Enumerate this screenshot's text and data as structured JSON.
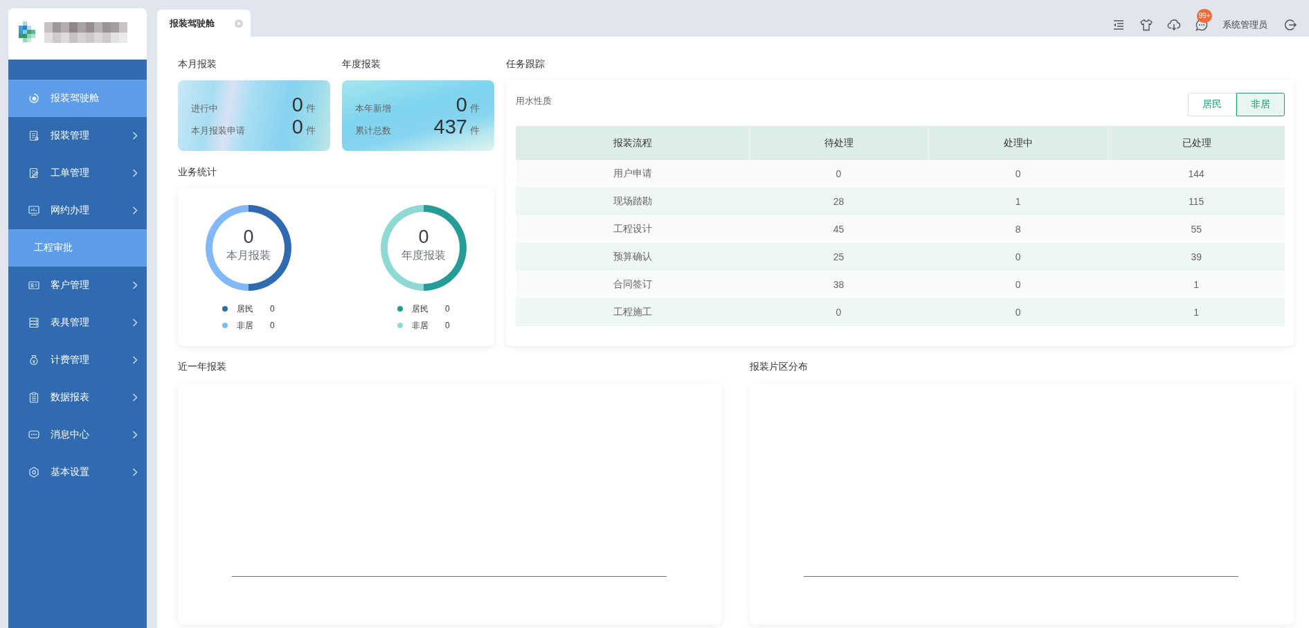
{
  "sidebar": {
    "items": [
      {
        "label": "报装驾驶舱",
        "kind": "link",
        "selected": true
      },
      {
        "label": "报装管理",
        "kind": "menu",
        "selected": false
      },
      {
        "label": "工单管理",
        "kind": "menu",
        "selected": false
      },
      {
        "label": "网约办理",
        "kind": "menu",
        "selected": false,
        "children": [
          {
            "label": "工程审批",
            "selected": true
          }
        ]
      },
      {
        "label": "客户管理",
        "kind": "menu",
        "selected": false
      },
      {
        "label": "表具管理",
        "kind": "menu",
        "selected": false
      },
      {
        "label": "计费管理",
        "kind": "menu",
        "selected": false
      },
      {
        "label": "数据报表",
        "kind": "menu",
        "selected": false
      },
      {
        "label": "消息中心",
        "kind": "menu",
        "selected": false
      },
      {
        "label": "基本设置",
        "kind": "menu",
        "selected": false
      }
    ]
  },
  "tabs": [
    {
      "label": "报装驾驶舱",
      "selected": true
    }
  ],
  "header": {
    "notification_badge": "99+",
    "user_name": "系统管理员"
  },
  "stat_panels": [
    {
      "title": "本月报装",
      "rows": [
        {
          "label": "进行中",
          "value": "0",
          "unit": "件"
        },
        {
          "label": "本月报装申请",
          "value": "0",
          "unit": "件"
        }
      ]
    },
    {
      "title": "年度报装",
      "rows": [
        {
          "label": "本年新增",
          "value": "0",
          "unit": "件"
        },
        {
          "label": "累计总数",
          "value": "437",
          "unit": "件"
        }
      ]
    }
  ],
  "business_stats": {
    "title": "业务统计",
    "donuts": [
      {
        "total": "0",
        "caption": "本月报装",
        "legend": [
          {
            "label": "居民",
            "value": "0",
            "color": "#2f6ab0"
          },
          {
            "label": "非居",
            "value": "0",
            "color": "#82b8f7"
          }
        ]
      },
      {
        "total": "0",
        "caption": "年度报装",
        "legend": [
          {
            "label": "居民",
            "value": "0",
            "color": "#269c97"
          },
          {
            "label": "非居",
            "value": "0",
            "color": "#8fd9d5"
          }
        ]
      }
    ]
  },
  "task_tracking": {
    "title": "任务跟踪",
    "filter_label": "用水性质",
    "toggle": [
      {
        "label": "居民",
        "selected": false
      },
      {
        "label": "非居",
        "selected": true
      }
    ],
    "table": {
      "columns": [
        "报装流程",
        "待处理",
        "处理中",
        "已处理"
      ],
      "rows": [
        [
          "用户申请",
          "0",
          "0",
          "144"
        ],
        [
          "现场踏勘",
          "28",
          "1",
          "115"
        ],
        [
          "工程设计",
          "45",
          "8",
          "55"
        ],
        [
          "预算确认",
          "25",
          "0",
          "39"
        ],
        [
          "合同签订",
          "38",
          "0",
          "1"
        ],
        [
          "工程施工",
          "0",
          "0",
          "1"
        ]
      ]
    }
  },
  "bottom_panels": [
    {
      "title": "近一年报装"
    },
    {
      "title": "报装片区分布"
    }
  ]
}
